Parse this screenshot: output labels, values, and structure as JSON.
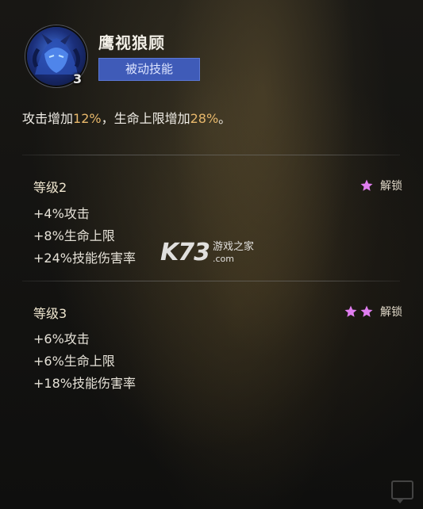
{
  "skill": {
    "name": "鹰视狼顾",
    "type": "被动技能",
    "level": "3",
    "description": {
      "part1": "攻击增加",
      "value1": "12%",
      "part2": "，生命上限增加",
      "value2": "28%",
      "part3": "。"
    }
  },
  "levels": [
    {
      "title": "等级2",
      "stars": 1,
      "unlock_label": "解锁",
      "bonuses": [
        "+4%攻击",
        "+8%生命上限",
        "+24%技能伤害率"
      ]
    },
    {
      "title": "等级3",
      "stars": 2,
      "unlock_label": "解锁",
      "bonuses": [
        "+6%攻击",
        "+6%生命上限",
        "+18%技能伤害率"
      ]
    }
  ],
  "watermark": {
    "brand": "K73",
    "cn": "游戏之家",
    "domain": ".com"
  },
  "colors": {
    "highlight": "#e8b86b",
    "type_badge": "#3f5bb8",
    "star": "#e07ef0"
  },
  "icons": [
    "hero-avatar",
    "star-icon",
    "chat-icon"
  ]
}
